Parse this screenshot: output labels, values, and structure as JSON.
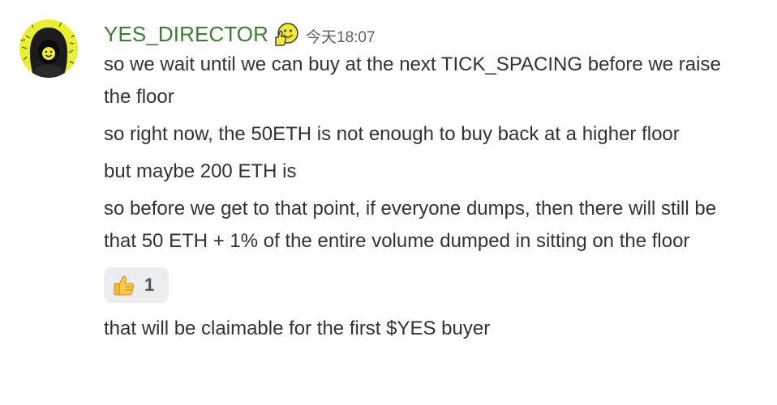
{
  "author": {
    "username": "YES_DIRECTOR",
    "role_icon": "thumbs-up-smiley-icon",
    "timestamp": "今天18:07",
    "avatar": "hooded-figure-avatar",
    "name_color": "#3e7c33"
  },
  "messages": [
    {
      "text": "so we wait until we can buy at the next TICK_SPACING before we raise the floor"
    },
    {
      "text": "so right now, the 50ETH is not enough to buy back at a higher floor"
    },
    {
      "text": "but maybe 200 ETH is"
    },
    {
      "text": "so before we get to that point, if everyone dumps, then there will still be that 50 ETH + 1% of the entire volume dumped in sitting on the floor"
    }
  ],
  "reaction": {
    "emoji": "thumbs-up-icon",
    "count": "1"
  },
  "last_message": {
    "text": "that will be claimable for the first $YES buyer"
  },
  "colors": {
    "text": "#2e3338",
    "timestamp": "#5c5e66",
    "reaction_bg": "#ebedef",
    "avatar_bg": "#e9ef34"
  }
}
